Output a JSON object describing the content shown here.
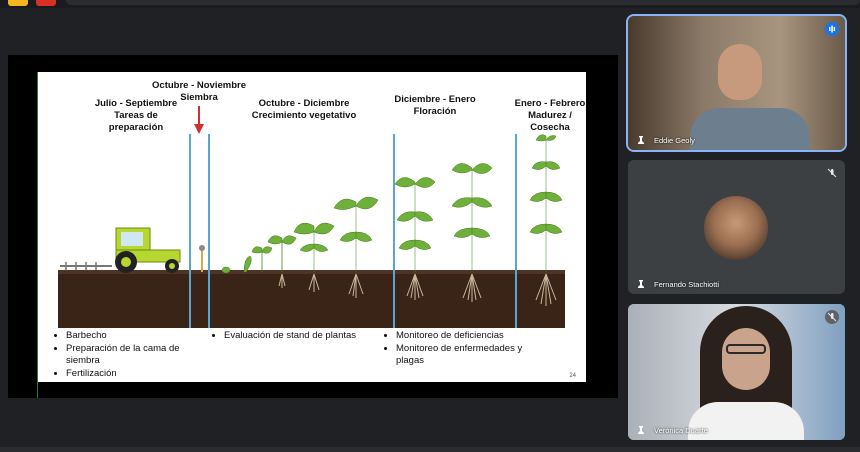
{
  "slide": {
    "phases": [
      {
        "id": "jul-sep",
        "lines": [
          "Julio - Septiembre",
          "Tareas de",
          "preparación"
        ]
      },
      {
        "id": "oct-nov",
        "lines": [
          "Octubre - Noviembre",
          "Siembra"
        ]
      },
      {
        "id": "oct-dic",
        "lines": [
          "Octubre - Diciembre",
          "Crecimiento vegetativo"
        ]
      },
      {
        "id": "dic-ene",
        "lines": [
          "Diciembre - Enero",
          "Floración"
        ]
      },
      {
        "id": "ene-feb",
        "lines": [
          "Enero - Febrero",
          "Madurez /",
          "Cosecha"
        ]
      }
    ],
    "bullets_prep": [
      "Barbecho",
      "Preparación de la cama de siembra",
      "Fertilización"
    ],
    "bullets_veg": [
      "Evaluación de stand de plantas"
    ],
    "bullets_flor": [
      "Monitoreo de deficiencias",
      "Monitoreo de enfermedades y plagas"
    ],
    "page_number": "24"
  },
  "participants": [
    {
      "name": "Eddie Geoly",
      "speaking": true
    },
    {
      "name": "Fernando Stachiotti",
      "speaking": false,
      "muted": true
    },
    {
      "name": "Verónica Duarte",
      "speaking": false,
      "muted": true
    }
  ],
  "icons": {
    "pin": "pin-icon",
    "mic_off": "mic-off-icon",
    "speaking": "speaking-indicator-icon"
  },
  "colors": {
    "accent": "#8ab4f8",
    "speaking_badge": "#1a73e8",
    "timeline_line": "#5aa6d1",
    "arrow": "#d32f2f",
    "tractor": "#b7d630"
  }
}
